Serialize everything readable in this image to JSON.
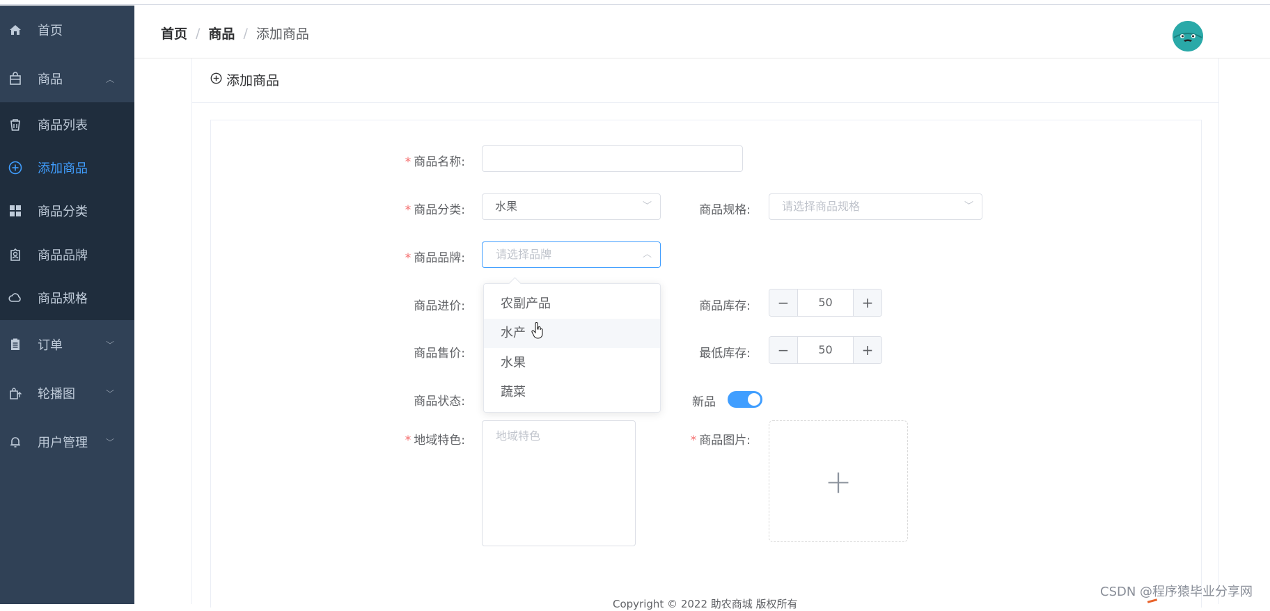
{
  "sidebar": {
    "items": [
      {
        "label": "首页",
        "icon": "home-icon"
      },
      {
        "label": "商品",
        "icon": "shopping-bag-icon",
        "expanded": true
      },
      {
        "label": "商品列表",
        "icon": "trash-bag-icon"
      },
      {
        "label": "添加商品",
        "icon": "circle-plus-icon",
        "active": true
      },
      {
        "label": "商品分类",
        "icon": "grid-icon"
      },
      {
        "label": "商品品牌",
        "icon": "badge-icon"
      },
      {
        "label": "商品规格",
        "icon": "cloud-icon"
      },
      {
        "label": "订单",
        "icon": "clipboard-icon"
      },
      {
        "label": "轮播图",
        "icon": "bag-upload-icon"
      },
      {
        "label": "用户管理",
        "icon": "bell-icon"
      }
    ],
    "colors": {
      "bg": "#304156",
      "submenu_bg": "#1f2d3d",
      "text": "#bfcbd9",
      "active": "#409eff"
    }
  },
  "header": {
    "breadcrumb": [
      "首页",
      "商品",
      "添加商品"
    ],
    "separator": "/"
  },
  "card": {
    "title": "添加商品"
  },
  "form": {
    "name_label": "商品名称:",
    "name_value": "",
    "category_label": "商品分类:",
    "category_value": "水果",
    "spec_label": "商品规格:",
    "spec_placeholder": "请选择商品规格",
    "brand_label": "商品品牌:",
    "brand_placeholder": "请选择品牌",
    "cost_label": "商品进价:",
    "stock_label": "商品库存:",
    "stock_value": "50",
    "price_label": "商品售价:",
    "min_stock_label": "最低库存:",
    "min_stock_value": "50",
    "status_label": "商品状态:",
    "new_label": "新品",
    "new_on": true,
    "region_label": "地域特色:",
    "region_placeholder": "地域特色",
    "image_label": "商品图片:",
    "required_mark": "*",
    "minus": "−",
    "plus": "+"
  },
  "dropdown": {
    "options": [
      "农副产品",
      "水产",
      "水果",
      "蔬菜"
    ],
    "hovered": "水产"
  },
  "footer": {
    "text": "Copyright © 2022 助农商城 版权所有"
  },
  "watermark": "CSDN @程序猿毕业分享网"
}
